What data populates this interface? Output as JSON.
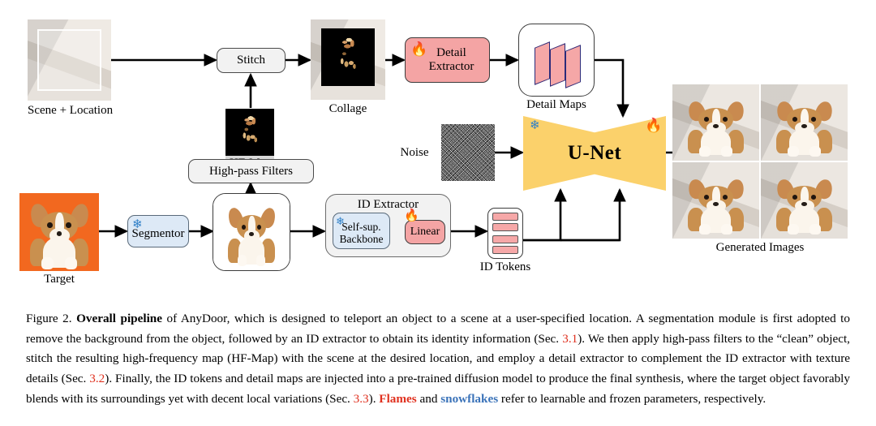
{
  "figure": {
    "number": "Figure 2.",
    "bold_lead": "Overall pipeline",
    "caption_part1": " of AnyDoor, which is designed to teleport an object to a scene at a user-specified location. A segmentation module is first adopted to remove the background from the object, followed by an ID extractor to obtain its identity information (Sec. ",
    "ref1": "3.1",
    "caption_part2": "). We then apply high-pass filters to the “clean” object, stitch the resulting high-frequency map (HF-Map) with the scene at the desired location, and employ a detail extractor to complement the ID extractor with texture details (Sec. ",
    "ref2": "3.2",
    "caption_part3": "). Finally, the ID tokens and detail maps are injected into a pre-trained diffusion model to produce the final synthesis, where the target object favorably blends with its surroundings yet with decent local variations (Sec. ",
    "ref3": "3.3",
    "caption_part4": "). ",
    "flames_word": "Flames",
    "caption_and": " and ",
    "snowflakes_word": "snowflakes",
    "caption_part5": " refer to learnable and frozen parameters, respectively."
  },
  "diagram": {
    "images": {
      "scene": {
        "label": "Scene + Location"
      },
      "hf_map": {
        "label": "HF-Map"
      },
      "collage": {
        "label": "Collage"
      },
      "target": {
        "label": "Target"
      },
      "clean_object": {
        "label": ""
      },
      "noise": {
        "label": "Noise"
      },
      "generated": {
        "label": "Generated Images"
      }
    },
    "blocks": {
      "stitch": {
        "label": "Stitch",
        "color": "#f2f2f2",
        "icon": "none"
      },
      "high_pass_filters": {
        "label": "High-pass Filters",
        "color": "#f2f2f2",
        "icon": "none"
      },
      "segmentor": {
        "label": "Segmentor",
        "color": "#dde9f6",
        "icon": "snowflake-icon"
      },
      "detail_extractor": {
        "label": "Detail\nExtractor",
        "color": "#f4a4a4",
        "icon": "flame-icon"
      },
      "detail_maps": {
        "label": "Detail Maps",
        "color": "#ffffff",
        "icon": "feature-maps-icon"
      },
      "id_extractor": {
        "label": "ID Extractor",
        "color": "#f2f2f2",
        "icon": "none"
      },
      "self_sup_backbone": {
        "label": "Self-sup.\nBackbone",
        "color": "#dde9f6",
        "icon": "snowflake-icon"
      },
      "linear": {
        "label": "Linear",
        "color": "#f4a4a4",
        "icon": "flame-icon"
      },
      "id_tokens": {
        "label": "ID Tokens",
        "color": "#ffffff",
        "icon": "token-stack-icon"
      },
      "unet": {
        "label": "U-Net",
        "color": "#fbd16b",
        "icon_left": "snowflake-icon",
        "icon_right": "flame-icon"
      }
    },
    "legend": {
      "flame_color": "#e02020",
      "snowflake_color": "#2f7fc7"
    }
  }
}
